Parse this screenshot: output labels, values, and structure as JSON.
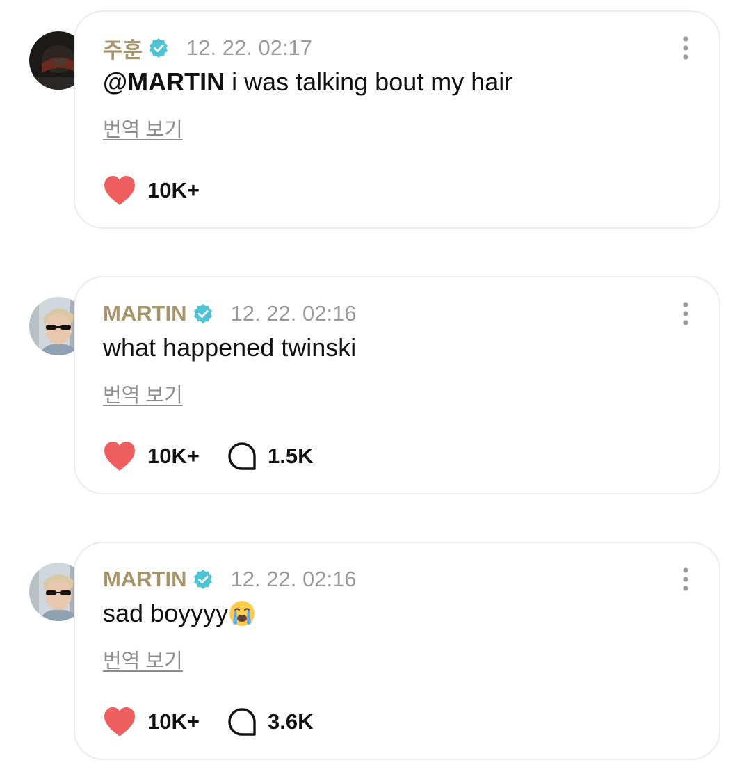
{
  "colors": {
    "author": "#a8946a",
    "verified_badge": "#4fc3d6",
    "like_heart": "#ee5e5e",
    "timestamp": "#9a9a9a",
    "card_border": "#ececec"
  },
  "comments": [
    {
      "author": "주훈",
      "verified": true,
      "timestamp": "12. 22. 02:17",
      "mention": "@MARTIN",
      "text": " i was talking bout my hair",
      "translate_label": "번역 보기",
      "likes": "10K+",
      "replies": null,
      "avatar_icon": "user-avatar-dark"
    },
    {
      "author": "MARTIN",
      "verified": true,
      "timestamp": "12. 22. 02:16",
      "mention": "",
      "text": "what happened twinski",
      "translate_label": "번역 보기",
      "likes": "10K+",
      "replies": "1.5K",
      "avatar_icon": "user-avatar-sunglasses"
    },
    {
      "author": "MARTIN",
      "verified": true,
      "timestamp": "12. 22. 02:16",
      "mention": "",
      "text": "sad boyyyy",
      "emoji": "loudly-crying-face-emoji",
      "translate_label": "번역 보기",
      "likes": "10K+",
      "replies": "3.6K",
      "avatar_icon": "user-avatar-sunglasses"
    }
  ]
}
